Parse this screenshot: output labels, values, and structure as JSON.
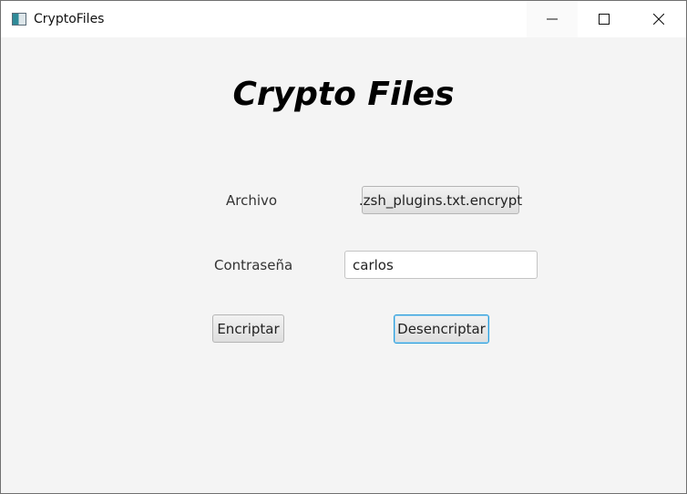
{
  "window": {
    "title": "CryptoFiles"
  },
  "controls": {
    "minimize_icon": "minimize-icon",
    "maximize_icon": "maximize-icon",
    "close_icon": "close-icon"
  },
  "main": {
    "heading": "Crypto Files",
    "file_label": "Archivo",
    "file_button": ".zsh_plugins.txt.encrypt",
    "password_label": "Contraseña",
    "password_value": "carlos",
    "encrypt_button": "Encriptar",
    "decrypt_button": "Desencriptar"
  },
  "colors": {
    "focus_border": "#2b9ddb",
    "window_bg": "#f4f4f4"
  }
}
